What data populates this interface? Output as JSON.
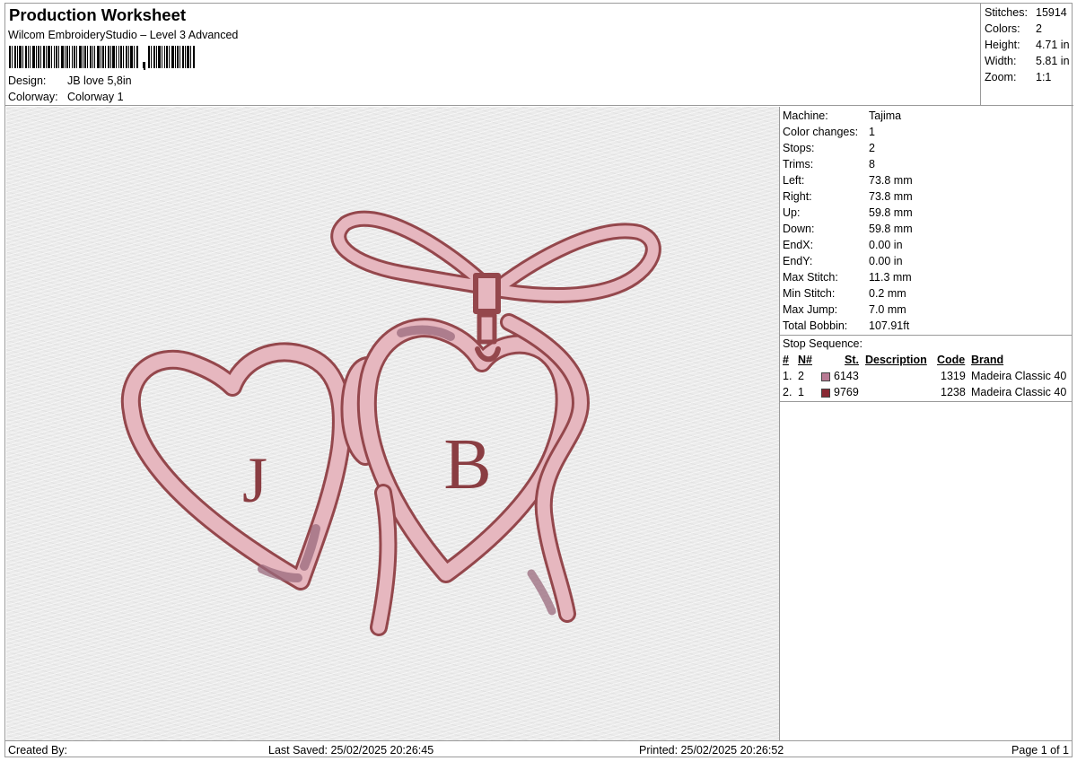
{
  "header": {
    "title": "Production Worksheet",
    "subtitle": "Wilcom EmbroideryStudio – Level 3 Advanced",
    "design_label": "Design:",
    "design_value": "JB love 5,8in",
    "colorway_label": "Colorway:",
    "colorway_value": "Colorway 1"
  },
  "stats": [
    {
      "label": "Stitches:",
      "value": "15914"
    },
    {
      "label": "Colors:",
      "value": "2"
    },
    {
      "label": "Height:",
      "value": "4.71 in"
    },
    {
      "label": "Width:",
      "value": "5.81 in"
    },
    {
      "label": "Zoom:",
      "value": "1:1"
    }
  ],
  "machine_info": [
    {
      "label": "Machine:",
      "value": "Tajima"
    },
    {
      "label": "Color changes:",
      "value": "1"
    },
    {
      "label": "Stops:",
      "value": "2"
    },
    {
      "label": "Trims:",
      "value": "8"
    },
    {
      "label": "Left:",
      "value": "73.8 mm"
    },
    {
      "label": "Right:",
      "value": "73.8 mm"
    },
    {
      "label": "Up:",
      "value": "59.8 mm"
    },
    {
      "label": "Down:",
      "value": "59.8 mm"
    },
    {
      "label": "EndX:",
      "value": "0.00 in"
    },
    {
      "label": "EndY:",
      "value": "0.00 in"
    },
    {
      "label": "Max Stitch:",
      "value": "11.3 mm"
    },
    {
      "label": "Min Stitch:",
      "value": "0.2 mm"
    },
    {
      "label": "Max Jump:",
      "value": "7.0 mm"
    },
    {
      "label": "Total Bobbin:",
      "value": "107.91ft"
    }
  ],
  "stop_sequence": {
    "title": "Stop Sequence:",
    "headers": {
      "num": "#",
      "n": "N#",
      "st": "St.",
      "description": "Description",
      "code": "Code",
      "brand": "Brand"
    },
    "rows": [
      {
        "index": "1.",
        "n": "2",
        "color": "#b87a93",
        "description": "6143",
        "code": "1319",
        "brand": "Madeira Classic 40"
      },
      {
        "index": "2.",
        "n": "1",
        "color": "#8a2a35",
        "description": "9769",
        "code": "1238",
        "brand": "Madeira Classic 40"
      }
    ]
  },
  "design": {
    "letter_left": "J",
    "letter_right": "B",
    "fill_color": "#e6b7bf",
    "outline_color": "#94474c",
    "shade_color": "#9a6a7c"
  },
  "footer": {
    "created_by": "Created By:",
    "last_saved": "Last Saved: 25/02/2025 20:26:45",
    "printed": "Printed: 25/02/2025 20:26:52",
    "page": "Page 1 of 1"
  }
}
